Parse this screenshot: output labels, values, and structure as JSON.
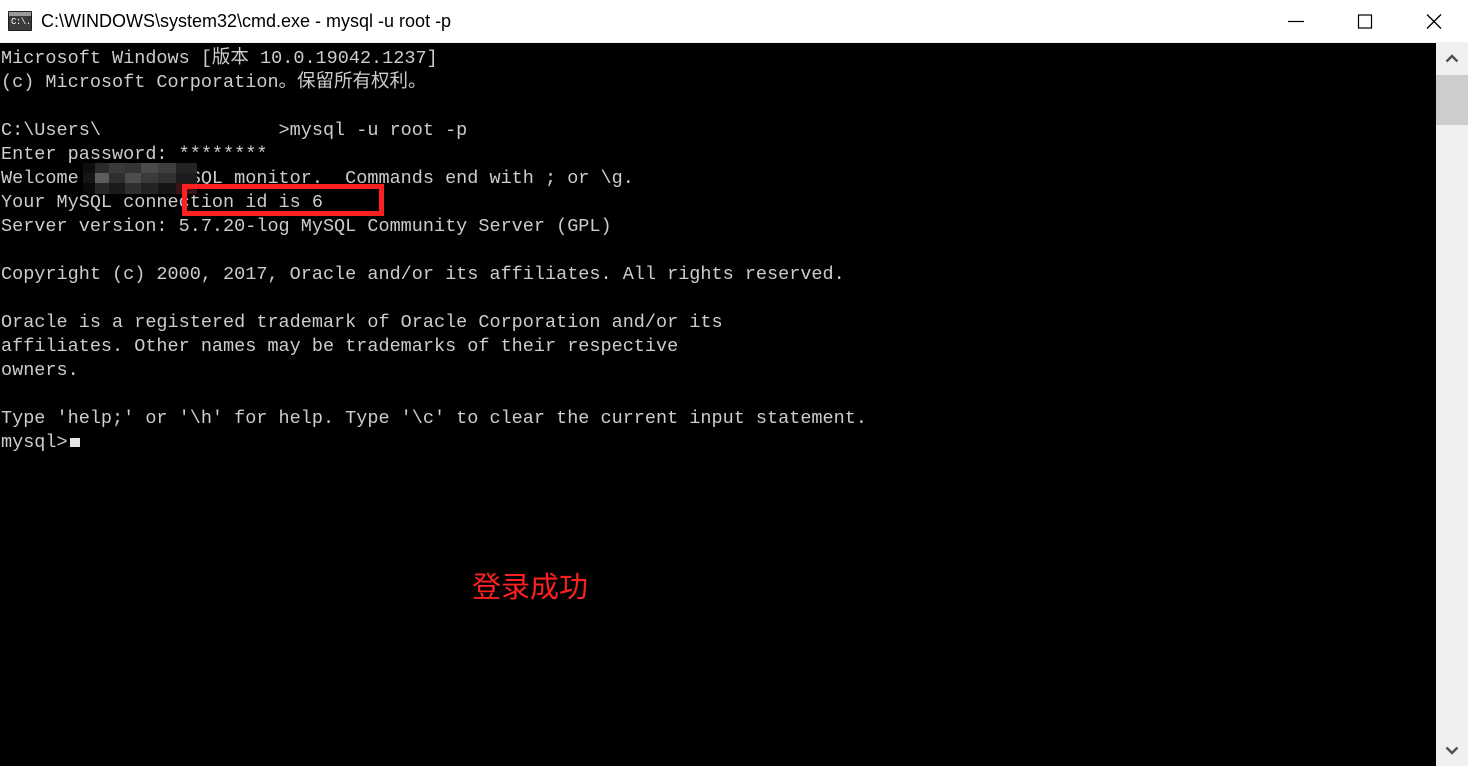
{
  "window": {
    "title": "C:\\WINDOWS\\system32\\cmd.exe - mysql  -u root -p",
    "icon_name": "cmd-console-icon",
    "icon_glyph": "C:\\.",
    "titlebar_bg": "#ffffff",
    "titlebar_fg": "#000000",
    "console_bg": "#000000",
    "console_fg": "#cccccc"
  },
  "controls": {
    "minimize_label": "Minimize",
    "maximize_label": "Maximize",
    "close_label": "Close"
  },
  "console": {
    "text": "Microsoft Windows [版本 10.0.19042.1237]\n(c) Microsoft Corporation。保留所有权利。\n\nC:\\Users\\                >mysql -u root -p\nEnter password: ********\nWelcome to the MySQL monitor.  Commands end with ; or \\g.\nYour MySQL connection id is 6\nServer version: 5.7.20-log MySQL Community Server (GPL)\n\nCopyright (c) 2000, 2017, Oracle and/or its affiliates. All rights reserved.\n\nOracle is a registered trademark of Oracle Corporation and/or its\naffiliates. Other names may be trademarks of their respective\nowners.\n\nType 'help;' or '\\h' for help. Type '\\c' to clear the current input statement.\n",
    "prompt": "mysql>",
    "cursor_name": "text-cursor-block",
    "redaction_label": "redacted-username"
  },
  "annotations": {
    "highlight_box": {
      "name": "password-highlight-box",
      "color": "#fc2020"
    },
    "note": {
      "text": "登录成功",
      "color": "#fc2020"
    }
  },
  "scrollbar": {
    "up_arrow_name": "scroll-up-arrow",
    "down_arrow_name": "scroll-down-arrow",
    "thumb_name": "scroll-thumb",
    "track_color": "#f0f0f0",
    "thumb_color": "#cdcdcd"
  }
}
